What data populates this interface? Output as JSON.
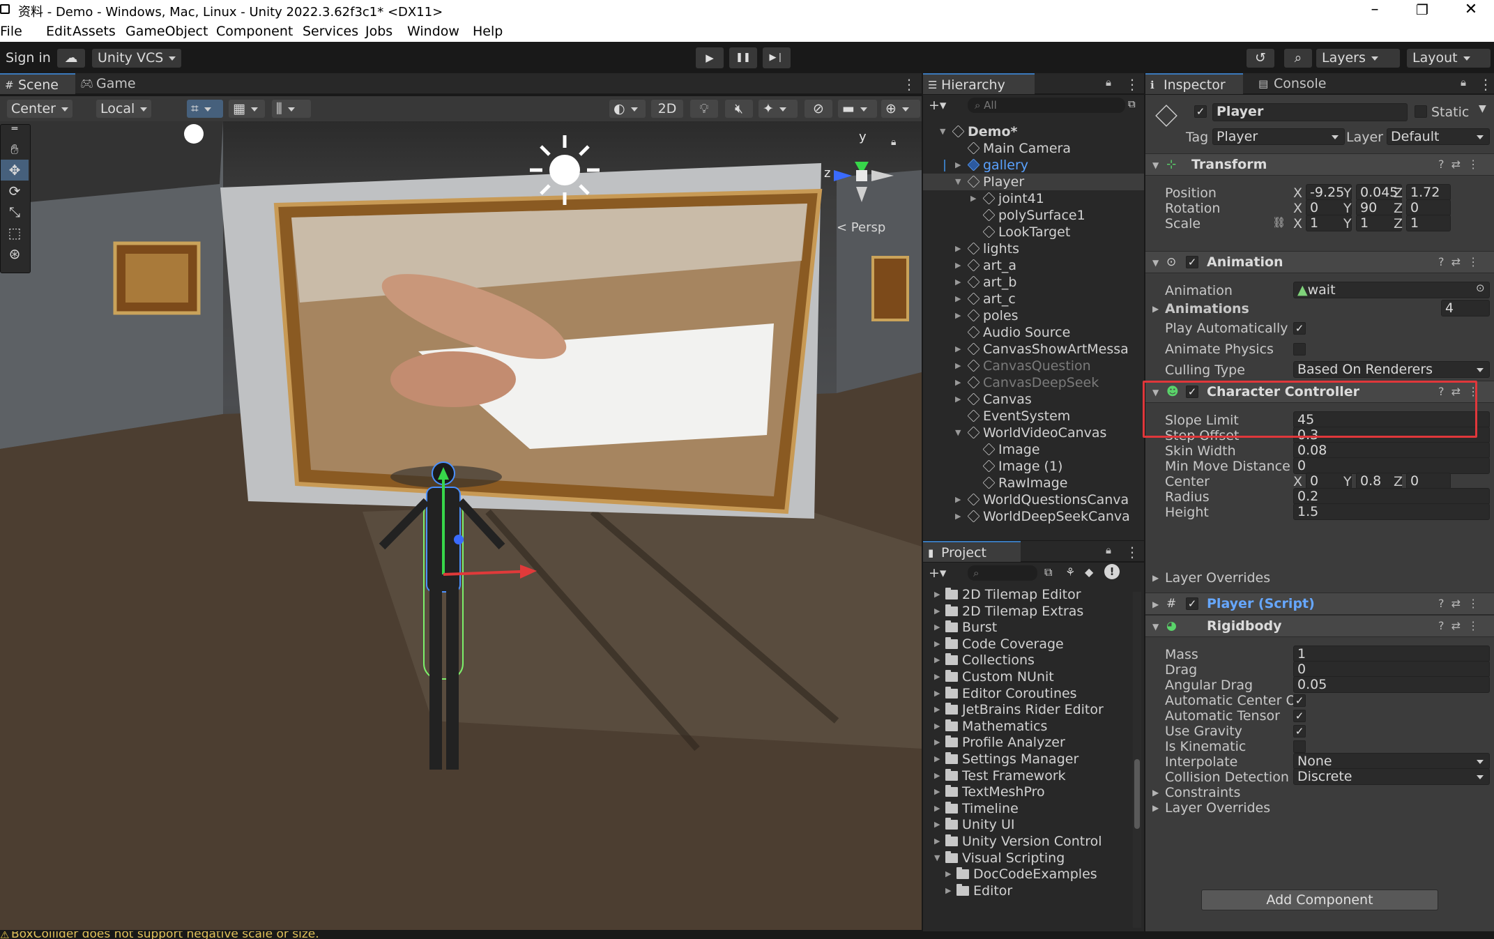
{
  "window": {
    "title": "资料 - Demo - Windows, Mac, Linux - Unity 2022.3.62f3c1* <DX11>",
    "minimize": "–",
    "maximize": "❐",
    "close": "✕"
  },
  "menu": [
    "File",
    "Edit",
    "Assets",
    "GameObject",
    "Component",
    "Services",
    "Jobs",
    "Window",
    "Help"
  ],
  "toolbar": {
    "sign_in": "Sign in",
    "vcs": "Unity VCS",
    "play": "▶",
    "pause": "❚❚",
    "step": "▶❘",
    "layers": "Layers",
    "layout": "Layout"
  },
  "scene_tabs": {
    "scene": "Scene",
    "game": "Game"
  },
  "scene_toolbar": {
    "pivot": "Center",
    "space": "Local",
    "mode_2d": "2D"
  },
  "viewport": {
    "persp_label": "< Persp",
    "axis_y": "y",
    "axis_z": "z"
  },
  "hierarchy": {
    "tab": "Hierarchy",
    "search_placeholder": "All",
    "add": "+▾",
    "items": [
      {
        "label": "Demo*",
        "depth": 0
      },
      {
        "label": "Main Camera",
        "depth": 1
      },
      {
        "label": "gallery",
        "depth": 1
      },
      {
        "label": "Player",
        "depth": 1
      },
      {
        "label": "joint41",
        "depth": 2
      },
      {
        "label": "polySurface1",
        "depth": 2
      },
      {
        "label": "LookTarget",
        "depth": 2
      },
      {
        "label": "lights",
        "depth": 1
      },
      {
        "label": "art_a",
        "depth": 1
      },
      {
        "label": "art_b",
        "depth": 1
      },
      {
        "label": "art_c",
        "depth": 1
      },
      {
        "label": "poles",
        "depth": 1
      },
      {
        "label": "Audio Source",
        "depth": 1
      },
      {
        "label": "CanvasShowArtMessa",
        "depth": 1
      },
      {
        "label": "CanvasQuestion",
        "depth": 1
      },
      {
        "label": "CanvasDeepSeek",
        "depth": 1
      },
      {
        "label": "Canvas",
        "depth": 1
      },
      {
        "label": "EventSystem",
        "depth": 1
      },
      {
        "label": "WorldVideoCanvas",
        "depth": 1
      },
      {
        "label": "Image",
        "depth": 2
      },
      {
        "label": "Image (1)",
        "depth": 2
      },
      {
        "label": "RawImage",
        "depth": 2
      },
      {
        "label": "WorldQuestionsCanva",
        "depth": 1
      },
      {
        "label": "WorldDeepSeekCanva",
        "depth": 1
      }
    ]
  },
  "project": {
    "tab": "Project",
    "add": "+▾",
    "folders": [
      "2D Tilemap Editor",
      "2D Tilemap Extras",
      "Burst",
      "Code Coverage",
      "Collections",
      "Custom NUnit",
      "Editor Coroutines",
      "JetBrains Rider Editor",
      "Mathematics",
      "Profile Analyzer",
      "Settings Manager",
      "Test Framework",
      "TextMeshPro",
      "Timeline",
      "Unity UI",
      "Unity Version Control",
      "Visual Scripting",
      "DocCodeExamples",
      "Editor"
    ]
  },
  "inspector": {
    "tab": "Inspector",
    "console_tab": "Console",
    "object_name": "Player",
    "static_label": "Static",
    "tag_label": "Tag",
    "tag_value": "Player",
    "layer_label": "Layer",
    "layer_value": "Default",
    "transform": {
      "title": "Transform",
      "position_label": "Position",
      "pos": {
        "x": "-9.25",
        "y": "0.045",
        "z": "1.72"
      },
      "rotation_label": "Rotation",
      "rot": {
        "x": "0",
        "y": "90",
        "z": "0"
      },
      "scale_label": "Scale",
      "scale": {
        "x": "1",
        "y": "1",
        "z": "1"
      }
    },
    "animation": {
      "title": "Animation",
      "animation_label": "Animation",
      "animation_value": "wait",
      "animations_label": "Animations",
      "animations_count": "4",
      "play_auto_label": "Play Automatically",
      "animate_physics_label": "Animate Physics",
      "culling_label": "Culling Type",
      "culling_value": "Based On Renderers"
    },
    "character_controller": {
      "title": "Character Controller",
      "slope_label": "Slope Limit",
      "slope": "45",
      "step_label": "Step Offset",
      "step": "0.3",
      "skin_label": "Skin Width",
      "skin": "0.08",
      "minmove_label": "Min Move Distance",
      "minmove": "0",
      "center_label": "Center",
      "center": {
        "x": "0",
        "y": "0.8",
        "z": "0"
      },
      "radius_label": "Radius",
      "radius": "0.2",
      "height_label": "Height",
      "height": "1.5",
      "overrides_label": "Layer Overrides"
    },
    "player_script": {
      "title": "Player (Script)"
    },
    "rigidbody": {
      "title": "Rigidbody",
      "mass_label": "Mass",
      "mass": "1",
      "drag_label": "Drag",
      "drag": "0",
      "angular_label": "Angular Drag",
      "angular": "0.05",
      "auto_com_label": "Automatic Center Of",
      "auto_tensor_label": "Automatic Tensor",
      "gravity_label": "Use Gravity",
      "kinematic_label": "Is Kinematic",
      "interpolate_label": "Interpolate",
      "interpolate": "None",
      "collision_label": "Collision Detection",
      "collision": "Discrete",
      "constraints_label": "Constraints",
      "overrides_label": "Layer Overrides"
    },
    "add_component": "Add Component",
    "x": "X",
    "y": "Y",
    "z": "Z"
  },
  "status": {
    "message": "BoxCollider does not support negative scale or size."
  },
  "colors": {
    "accent": "#3a79bb",
    "highlight": "#e0373b",
    "selection": "#46607c"
  }
}
